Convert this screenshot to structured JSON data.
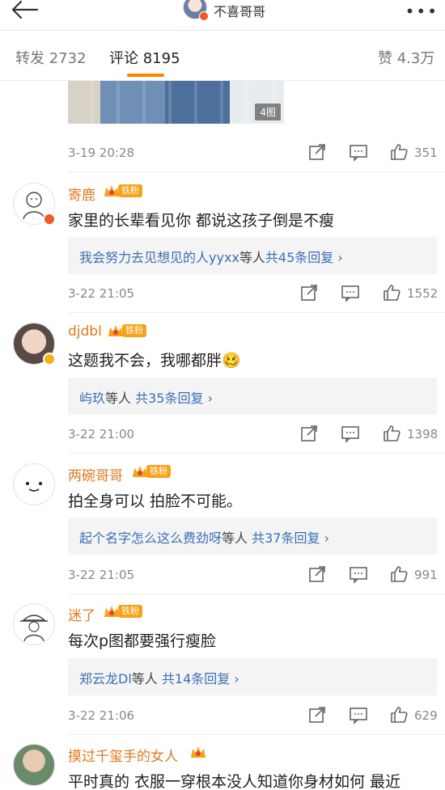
{
  "header": {
    "user_name": "不喜哥哥",
    "more_label": "•••"
  },
  "tabs": [
    {
      "label": "转发 2732"
    },
    {
      "label": "评论 8195"
    },
    {
      "label": "赞 4.3万"
    }
  ],
  "post": {
    "image_badge": "4图",
    "time": "3-19 20:28",
    "likes": "351"
  },
  "comments": [
    {
      "name": "寄鹿",
      "fan_tag": "铁粉",
      "text": "家里的长辈看见你 都说这孩子倒是不瘦",
      "reply_who": "我会努力去见想见的人yyxx",
      "reply_suffix": "等人",
      "reply_count": "共45条回复",
      "time": "3-22 21:05",
      "likes": "1552"
    },
    {
      "name": "djdbl",
      "fan_tag": "铁粉",
      "text": "这题我不会，我哪都胖🥴",
      "reply_who": "屿玖",
      "reply_suffix": "等人",
      "reply_count": "共35条回复",
      "time": "3-22 21:00",
      "likes": "1398"
    },
    {
      "name": "两碗哥哥",
      "fan_tag": "铁粉",
      "text": "拍全身可以 拍脸不可能。",
      "reply_who": "起个名字怎么这么费劲呀",
      "reply_suffix": "等人",
      "reply_count": "共37条回复",
      "time": "3-22 21:05",
      "likes": "991"
    },
    {
      "name": "迷了",
      "fan_tag": "铁粉",
      "text": "每次p图都要强行瘦脸",
      "reply_who": "郑云龙Dl",
      "reply_suffix": "等人",
      "reply_count": "共14条回复",
      "time": "3-22 21:06",
      "likes": "629"
    },
    {
      "name": "摸过千玺手的女人",
      "text": "平时真的 衣服一穿根本没人知道你身材如何 最近"
    }
  ],
  "colors": {
    "accent": "#ff8200",
    "username": "#e07a1f",
    "link": "#3b6fb6",
    "badge": "#f7a21b"
  }
}
